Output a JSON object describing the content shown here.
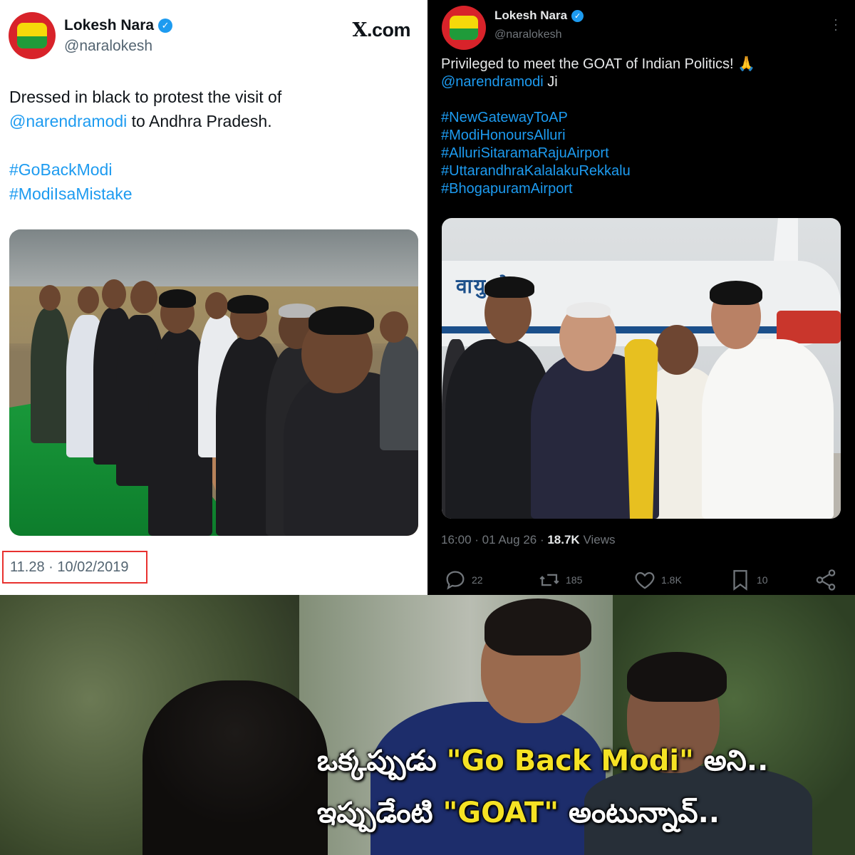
{
  "left_tweet": {
    "display_name": "Lokesh Nara",
    "handle": "@naralokesh",
    "site_badge": ".com",
    "site_badge_glyph": "X",
    "text_line1": "Dressed in black to protest the visit of",
    "mention": "@narendramodi",
    "text_line2_rest": " to Andhra Pradesh.",
    "hashtags": [
      "#GoBackModi",
      "#ModiIsaMistake"
    ],
    "timestamp": "11.28 · 10/02/2019",
    "highlight_color": "#e8312f"
  },
  "right_tweet": {
    "display_name": "Lokesh Nara",
    "handle": "@naralokesh",
    "text_line1": "Privileged to meet the GOAT of Indian Politics! 🙏",
    "mention": "@narendramodi",
    "mention_suffix": " Ji",
    "hashtags": [
      "#NewGatewayToAP",
      "#ModiHonoursAlluri",
      "#AlluriSitaramaRajuAirport",
      "#UttarandhraKalalakuRekkalu",
      "#BhogapuramAirport"
    ],
    "time_date": "16:00 · 01 Aug 26 · ",
    "views_count": "18.7K",
    "views_label": " Views",
    "actions": {
      "replies": "22",
      "reposts": "185",
      "likes": "1.8K",
      "bookmarks": "10"
    }
  },
  "meme_caption": {
    "line1_prefix": "ఒక్కప్పుడు ",
    "line1_highlight": "\"Go Back Modi\"",
    "line1_suffix": " అని..",
    "line2_prefix": "ఇప్పుడేంటి ",
    "line2_highlight": "\"GOAT\"",
    "line2_suffix": " అంటున్నావ్.."
  },
  "colors": {
    "link_blue": "#1d9bf0",
    "caption_yellow": "#f5e224",
    "verified_blue": "#1d9bf0"
  },
  "icons": [
    "verified-badge-icon",
    "more-options-icon",
    "reply-icon",
    "repost-icon",
    "like-icon",
    "bookmark-icon",
    "share-icon"
  ]
}
